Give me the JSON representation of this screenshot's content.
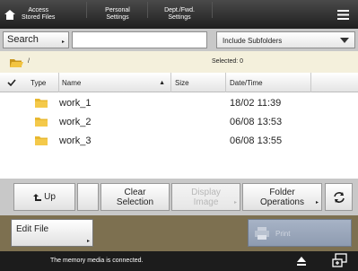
{
  "topbar": {
    "access_label": "Access\nStored Files",
    "personal_label": "Personal\nSettings",
    "dept_label": "Dept./Fwd.\nSettings",
    "menu_icon": "menu-icon"
  },
  "search": {
    "button_label": "Search",
    "input_value": "",
    "subfolder_label": "Include Subfolders"
  },
  "path": {
    "text": "/",
    "selected_text": "Selected: 0"
  },
  "table": {
    "columns": {
      "type": "Type",
      "name": "Name",
      "size": "Size",
      "date": "Date/Time"
    },
    "rows": [
      {
        "name": "work_1",
        "size": "",
        "date": "18/02 11:39"
      },
      {
        "name": "work_2",
        "size": "",
        "date": "06/08 13:53"
      },
      {
        "name": "work_3",
        "size": "",
        "date": "06/08 13:55"
      }
    ]
  },
  "ops": {
    "up_label": "Up",
    "clear_label": "Clear\nSelection",
    "display_label": "Display\nImage",
    "folder_label": "Folder\nOperations"
  },
  "edit": {
    "edit_label": "Edit File",
    "print_label": "Print"
  },
  "status": {
    "message": "The memory media is connected."
  },
  "colors": {
    "topbar": "#2d2d2d",
    "path_bg": "#f4f0dc",
    "edit_bg": "#7d7050",
    "folder": "#e8b830",
    "print_disabled": "#9aa6ba"
  }
}
